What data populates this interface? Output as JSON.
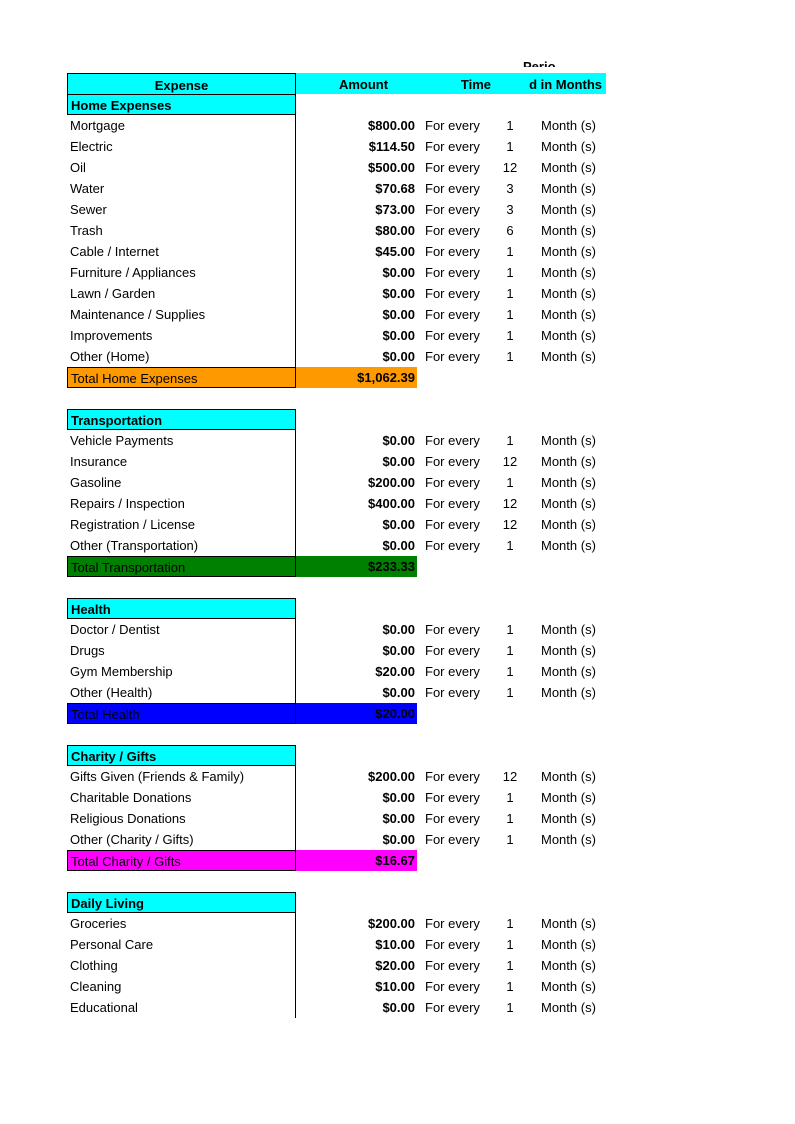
{
  "header": {
    "expense": "Expense",
    "amount": "Amount",
    "time": "Time",
    "period_top": "Perio",
    "period": "d in Months"
  },
  "colors": {
    "header_bg": "#00ffff",
    "home_total": "#ff9900",
    "transportation_total": "#008000",
    "health_total": "#0000ff",
    "charity_total": "#ff00ff"
  },
  "sections": [
    {
      "title": "Home Expenses",
      "items": [
        {
          "name": "Mortgage",
          "amount": "$800.00",
          "time": "For every",
          "period": "1",
          "unit": "Month (s)"
        },
        {
          "name": "Electric",
          "amount": "$114.50",
          "time": "For every",
          "period": "1",
          "unit": "Month (s)"
        },
        {
          "name": "Oil",
          "amount": "$500.00",
          "time": "For every",
          "period": "12",
          "unit": "Month (s)"
        },
        {
          "name": "Water",
          "amount": "$70.68",
          "time": "For every",
          "period": "3",
          "unit": "Month (s)"
        },
        {
          "name": "Sewer",
          "amount": "$73.00",
          "time": "For every",
          "period": "3",
          "unit": "Month (s)"
        },
        {
          "name": "Trash",
          "amount": "$80.00",
          "time": "For every",
          "period": "6",
          "unit": "Month (s)"
        },
        {
          "name": "Cable / Internet",
          "amount": "$45.00",
          "time": "For every",
          "period": "1",
          "unit": "Month (s)"
        },
        {
          "name": "Furniture / Appliances",
          "amount": "$0.00",
          "time": "For every",
          "period": "1",
          "unit": "Month (s)"
        },
        {
          "name": "Lawn / Garden",
          "amount": "$0.00",
          "time": "For every",
          "period": "1",
          "unit": "Month (s)"
        },
        {
          "name": "Maintenance / Supplies",
          "amount": "$0.00",
          "time": "For every",
          "period": "1",
          "unit": "Month (s)"
        },
        {
          "name": "Improvements",
          "amount": "$0.00",
          "time": "For every",
          "period": "1",
          "unit": "Month (s)"
        },
        {
          "name": "Other (Home)",
          "amount": "$0.00",
          "time": "For every",
          "period": "1",
          "unit": "Month (s)"
        }
      ],
      "total_label": "Total Home Expenses",
      "total_value": "$1,062.39",
      "total_color": "#ff9900"
    },
    {
      "title": "Transportation",
      "items": [
        {
          "name": "Vehicle Payments",
          "amount": "$0.00",
          "time": "For every",
          "period": "1",
          "unit": "Month (s)"
        },
        {
          "name": "Insurance",
          "amount": "$0.00",
          "time": "For every",
          "period": "12",
          "unit": "Month (s)"
        },
        {
          "name": "Gasoline",
          "amount": "$200.00",
          "time": "For every",
          "period": "1",
          "unit": "Month (s)"
        },
        {
          "name": "Repairs / Inspection",
          "amount": "$400.00",
          "time": "For every",
          "period": "12",
          "unit": "Month (s)"
        },
        {
          "name": "Registration / License",
          "amount": "$0.00",
          "time": "For every",
          "period": "12",
          "unit": "Month (s)"
        },
        {
          "name": "Other (Transportation)",
          "amount": "$0.00",
          "time": "For every",
          "period": "1",
          "unit": "Month (s)"
        }
      ],
      "total_label": "Total Transportation",
      "total_value": "$233.33",
      "total_color": "#008000"
    },
    {
      "title": "Health",
      "items": [
        {
          "name": "Doctor / Dentist",
          "amount": "$0.00",
          "time": "For every",
          "period": "1",
          "unit": "Month (s)"
        },
        {
          "name": "Drugs",
          "amount": "$0.00",
          "time": "For every",
          "period": "1",
          "unit": "Month (s)"
        },
        {
          "name": "Gym Membership",
          "amount": "$20.00",
          "time": "For every",
          "period": "1",
          "unit": "Month (s)"
        },
        {
          "name": "Other (Health)",
          "amount": "$0.00",
          "time": "For every",
          "period": "1",
          "unit": "Month (s)"
        }
      ],
      "total_label": "Total Health",
      "total_value": "$20.00",
      "total_color": "#0000ff"
    },
    {
      "title": "Charity / Gifts",
      "items": [
        {
          "name": "Gifts Given (Friends & Family)",
          "amount": "$200.00",
          "time": "For every",
          "period": "12",
          "unit": "Month (s)"
        },
        {
          "name": "Charitable Donations",
          "amount": "$0.00",
          "time": "For every",
          "period": "1",
          "unit": "Month (s)"
        },
        {
          "name": "Religious Donations",
          "amount": "$0.00",
          "time": "For every",
          "period": "1",
          "unit": "Month (s)"
        },
        {
          "name": "Other (Charity / Gifts)",
          "amount": "$0.00",
          "time": "For every",
          "period": "1",
          "unit": "Month (s)"
        }
      ],
      "total_label": "Total Charity / Gifts",
      "total_value": "$16.67",
      "total_color": "#ff00ff"
    },
    {
      "title": "Daily Living",
      "items": [
        {
          "name": "Groceries",
          "amount": "$200.00",
          "time": "For every",
          "period": "1",
          "unit": "Month (s)"
        },
        {
          "name": "Personal Care",
          "amount": "$10.00",
          "time": "For every",
          "period": "1",
          "unit": "Month (s)"
        },
        {
          "name": "Clothing",
          "amount": "$20.00",
          "time": "For every",
          "period": "1",
          "unit": "Month (s)"
        },
        {
          "name": "Cleaning",
          "amount": "$10.00",
          "time": "For every",
          "period": "1",
          "unit": "Month (s)"
        },
        {
          "name": "Educational",
          "amount": "$0.00",
          "time": "For every",
          "period": "1",
          "unit": "Month (s)"
        }
      ]
    }
  ]
}
